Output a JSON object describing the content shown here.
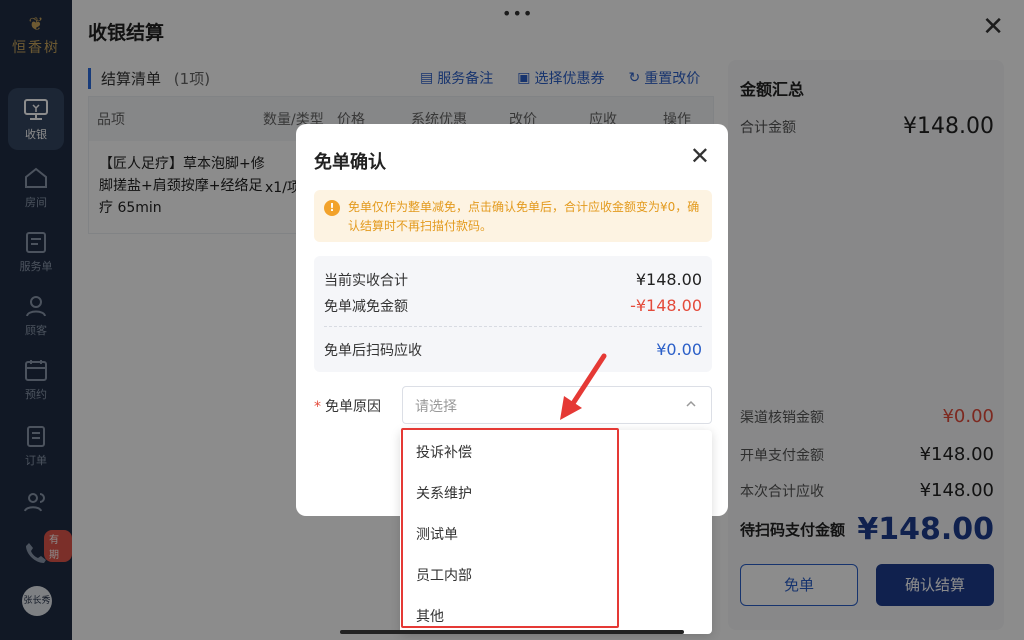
{
  "sidebar": {
    "logo": "恒香树",
    "items": [
      {
        "label": "收银",
        "icon": "cashier-icon"
      },
      {
        "label": "房间",
        "icon": "home-icon"
      },
      {
        "label": "服务单",
        "icon": "service-order-icon"
      },
      {
        "label": "顾客",
        "icon": "user-icon"
      },
      {
        "label": "预约",
        "icon": "calendar-icon"
      },
      {
        "label": "订单",
        "icon": "order-icon"
      },
      {
        "label": "",
        "icon": "group-icon"
      },
      {
        "label": "",
        "icon": "phone-icon"
      }
    ],
    "badge": "有期",
    "avatar": "张长秀"
  },
  "header": {
    "title": "收银结算",
    "handle": "•••"
  },
  "settlement": {
    "title": "结算清单",
    "count": "(1项)",
    "actions": [
      "服务备注",
      "选择优惠券",
      "重置改价"
    ],
    "columns": [
      "品项",
      "数量/类型",
      "价格",
      "系统优惠",
      "改价",
      "应收",
      "操作"
    ],
    "rows": [
      {
        "product": "【匠人足疗】草本泡脚+修脚搓盐+肩颈按摩+经络足疗 65min",
        "qty": "x1/项"
      }
    ]
  },
  "summary": {
    "title": "金额汇总",
    "total_label": "合计金额",
    "total_value": "¥148.00",
    "rows": [
      {
        "label": "渠道核销金额",
        "value": "¥0.00"
      },
      {
        "label": "开单支付金额",
        "value": "¥148.00"
      },
      {
        "label": "本次合计应收",
        "value": "¥148.00"
      }
    ],
    "pending_label": "待扫码支付金额",
    "pending_value": "¥148.00",
    "free_button": "免单",
    "confirm_button": "确认结算"
  },
  "modal": {
    "title": "免单确认",
    "alert": "免单仅作为整单减免，点击确认免单后，合计应收金额变为¥0，确认结算时不再扫描付款码。",
    "amounts": [
      {
        "label": "当前实收合计",
        "value": "¥148.00"
      },
      {
        "label": "免单减免金额",
        "value": "-¥148.00"
      },
      {
        "label": "免单后扫码应收",
        "value": "¥0.00"
      }
    ],
    "reason_required": "*",
    "reason_label": "免单原因",
    "reason_placeholder": "请选择",
    "options": [
      "投诉补偿",
      "关系维护",
      "测试单",
      "员工内部",
      "其他"
    ]
  },
  "colors": {
    "sidebar": "#1f2d44",
    "primary": "#1e3d8f",
    "link": "#2b5fc8",
    "danger": "#e44b3b",
    "warning": "#f2a22b",
    "highlight": "#e53935"
  }
}
